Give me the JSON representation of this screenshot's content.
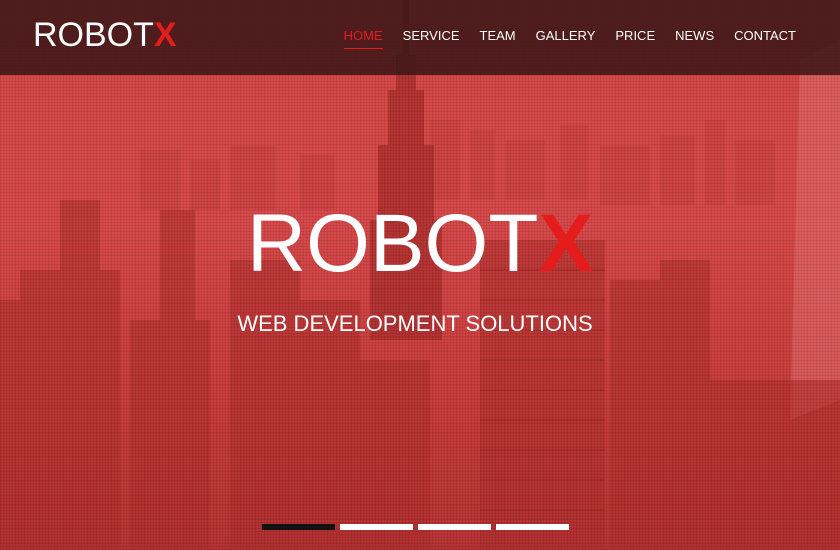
{
  "header": {
    "logo_main": "ROBOT",
    "logo_accent": "X",
    "nav": [
      {
        "label": "HOME",
        "active": true
      },
      {
        "label": "SERVICE",
        "active": false
      },
      {
        "label": "TEAM",
        "active": false
      },
      {
        "label": "GALLERY",
        "active": false
      },
      {
        "label": "PRICE",
        "active": false
      },
      {
        "label": "NEWS",
        "active": false
      },
      {
        "label": "CONTACT",
        "active": false
      }
    ]
  },
  "hero": {
    "title_main": "ROBOT",
    "title_accent": "X",
    "subtitle": "WEB DEVELOPMENT SOLUTIONS",
    "slides": 4,
    "active_slide": 1
  },
  "colors": {
    "accent": "#e51c1c",
    "header_bg": "#3a1616",
    "hero_tint": "#d94a4a"
  }
}
